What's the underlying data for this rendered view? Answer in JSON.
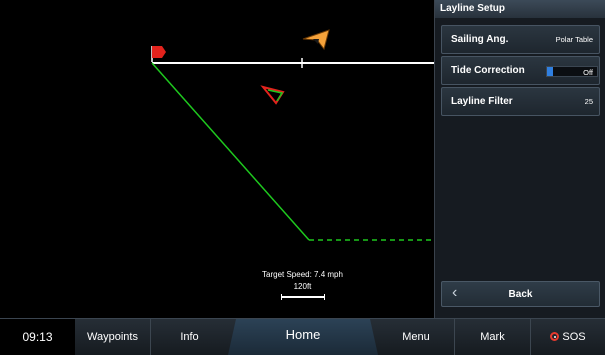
{
  "map": {
    "target_speed": "Target Speed: 7.4 mph",
    "scale": "120ft",
    "colors": {
      "layline_port": "#1ec81e",
      "start_line": "#ffffff",
      "boat_marker": "#f5a23a",
      "flag": "#e3231d"
    }
  },
  "panel": {
    "title": "Layline Setup",
    "sailing_angle": {
      "label": "Sailing Ang.",
      "value": "Polar Table"
    },
    "tide_correction": {
      "label": "Tide Correction",
      "value": "Off"
    },
    "layline_filter": {
      "label": "Layline Filter",
      "value": "25"
    },
    "back_label": "Back"
  },
  "bottombar": {
    "time": "09:13",
    "waypoints": "Waypoints",
    "info": "Info",
    "home": "Home",
    "menu": "Menu",
    "mark": "Mark",
    "sos": "SOS"
  }
}
